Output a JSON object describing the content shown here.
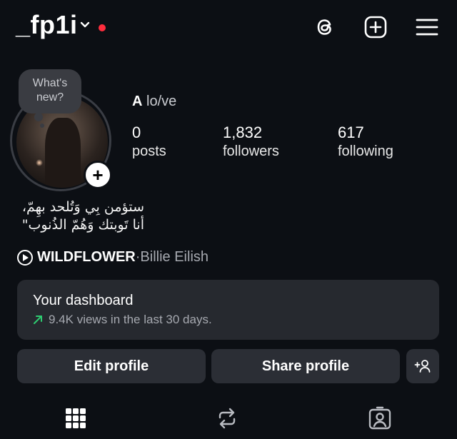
{
  "header": {
    "username": "_fp1i",
    "icons": [
      "chevron-down-icon",
      "threads-icon",
      "new-post-icon",
      "menu-icon"
    ],
    "notification_color": "#ff2d3d"
  },
  "profile": {
    "note_bubble_line1": "What's",
    "note_bubble_line2": "new?",
    "add_story": "+",
    "full_name_bold": "A",
    "full_name_rest": " lo/ve",
    "stats": {
      "posts_count": "0",
      "posts_label": "posts",
      "followers_count": "1,832",
      "followers_label": "followers",
      "following_count": "617",
      "following_label": "following"
    },
    "bio_line1": "ستؤمن بِي وَتُلحد بهِمّ،",
    "bio_line2": "أنا تَوبتك وَهُمّ الذُنوب\""
  },
  "music": {
    "song": "WILDFLOWER",
    "separator": " · ",
    "artist": "Billie Eilish"
  },
  "dashboard": {
    "title": "Your dashboard",
    "subtitle": "9.4K views in the last 30 days.",
    "trend_icon": "arrow-up-right-icon",
    "trend_color": "#2ecc71"
  },
  "actions": {
    "edit_label": "Edit profile",
    "share_label": "Share profile",
    "discover_icon": "add-person-icon"
  },
  "tabs": [
    "grid-icon",
    "reels-repost-icon",
    "tagged-icon"
  ],
  "colors": {
    "background": "#0c0f14",
    "card": "#26292f",
    "button": "#2b2e35"
  }
}
